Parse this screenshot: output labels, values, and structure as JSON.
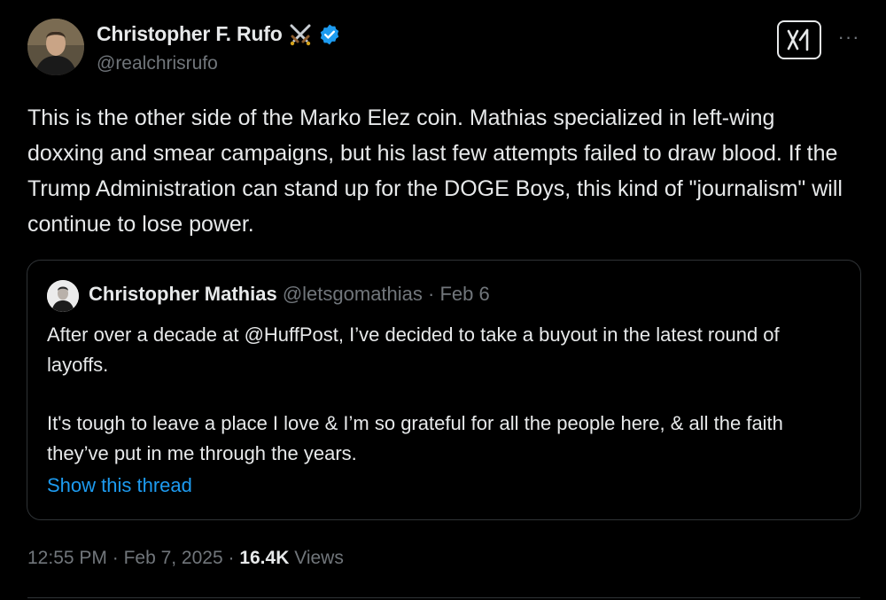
{
  "author": {
    "name": "Christopher F. Rufo",
    "emoji_icon": "crossed-swords-icon",
    "verified_icon": "verified-badge-icon",
    "handle": "@realchrisrufo"
  },
  "toolbar": {
    "grok_icon": "grok-icon",
    "more_icon": "more-options-icon",
    "more_label": "···"
  },
  "post": {
    "text": "This is the other side of the Marko Elez coin. Mathias specialized in left-wing doxxing and smear campaigns, but his last few attempts failed to draw blood. If the Trump Administration can stand up for the DOGE Boys, this kind of \"journalism\" will continue to lose power."
  },
  "quote": {
    "name": "Christopher Mathias",
    "handle": "@letsgomathias",
    "separator": " · ",
    "date": "Feb 6",
    "paragraph1": "After over a decade at @HuffPost, I’ve decided to take a buyout in the latest round of layoffs.",
    "paragraph2": "It's tough to leave a place I love & I’m so grateful for all the people here, & all the faith they’ve put in me through the years.",
    "show_thread": "Show this thread"
  },
  "footer": {
    "time": "12:55 PM",
    "separator": " · ",
    "date": "Feb 7, 2025",
    "views_count": "16.4K",
    "views_label": " Views"
  },
  "colors": {
    "background": "#000000",
    "text": "#e7e9ea",
    "muted": "#71767b",
    "link": "#1d9bf0",
    "verified": "#1d9bf0",
    "border": "#2f3336"
  }
}
